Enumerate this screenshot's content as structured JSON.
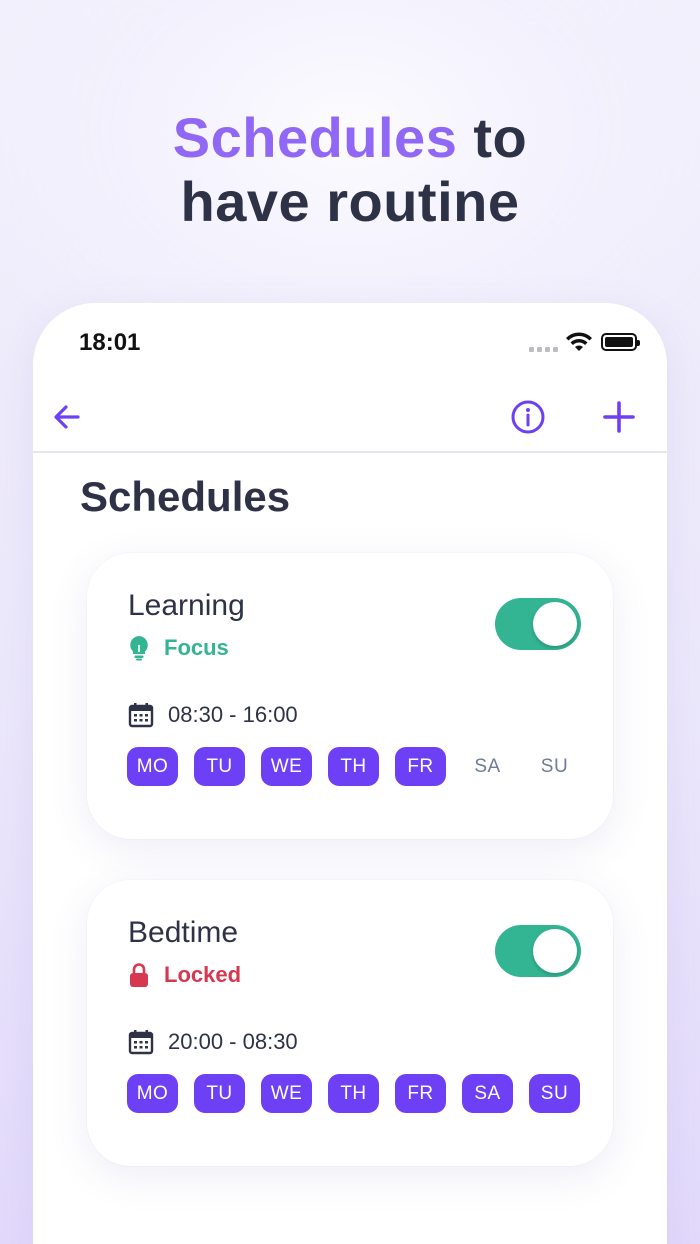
{
  "headline": {
    "accent": "Schedules",
    "rest_line1": " to",
    "line2": "have routine"
  },
  "status_bar": {
    "time": "18:01"
  },
  "page_title": "Schedules",
  "colors": {
    "accent": "#6e40f5",
    "focus": "#33b594",
    "locked": "#d8384f",
    "toggle_on": "#33b594"
  },
  "schedules": [
    {
      "title": "Learning",
      "mode": "Focus",
      "mode_icon": "lightbulb-icon",
      "time": "08:30 - 16:00",
      "enabled": true,
      "days": [
        {
          "label": "MO",
          "active": true
        },
        {
          "label": "TU",
          "active": true
        },
        {
          "label": "WE",
          "active": true
        },
        {
          "label": "TH",
          "active": true
        },
        {
          "label": "FR",
          "active": true
        },
        {
          "label": "SA",
          "active": false
        },
        {
          "label": "SU",
          "active": false
        }
      ]
    },
    {
      "title": "Bedtime",
      "mode": "Locked",
      "mode_icon": "lock-icon",
      "time": "20:00 - 08:30",
      "enabled": true,
      "days": [
        {
          "label": "MO",
          "active": true
        },
        {
          "label": "TU",
          "active": true
        },
        {
          "label": "WE",
          "active": true
        },
        {
          "label": "TH",
          "active": true
        },
        {
          "label": "FR",
          "active": true
        },
        {
          "label": "SA",
          "active": true
        },
        {
          "label": "SU",
          "active": true
        }
      ]
    }
  ]
}
